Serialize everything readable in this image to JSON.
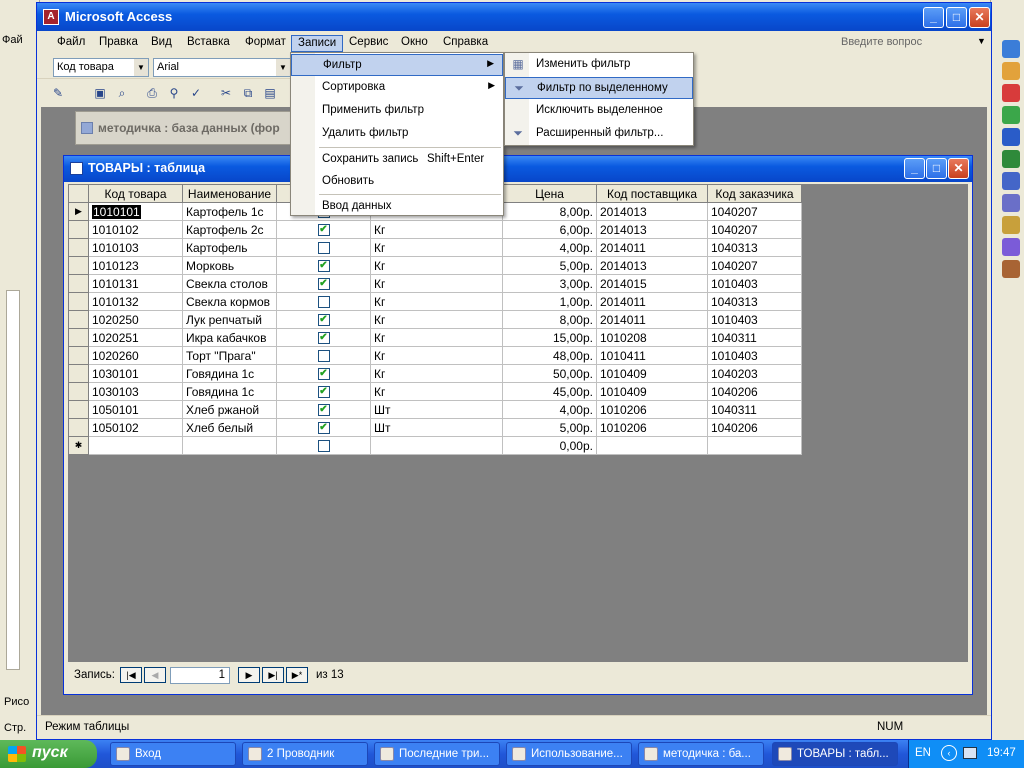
{
  "background_word": {
    "left_labels": [
      "Фай"
    ],
    "bottom_labels": [
      "Рисо",
      "Стр."
    ]
  },
  "access": {
    "title": "Microsoft Access",
    "menu": [
      "Файл",
      "Правка",
      "Вид",
      "Вставка",
      "Формат",
      "Записи",
      "Сервис",
      "Окно",
      "Справка"
    ],
    "ask_placeholder": "Введите вопрос",
    "field_combo": "Код товара",
    "font_combo": "Arial",
    "ghost_form_title": "методичка : база данных (фор",
    "status_text": "Режим таблицы",
    "status_num": "NUM"
  },
  "table_window": {
    "title": "ТОВАРЫ : таблица",
    "columns": [
      "Код товара",
      "Наименование",
      "О",
      "",
      "Цена",
      "Код поставщика",
      "Код заказчика"
    ],
    "rows": [
      {
        "code": "1010101",
        "name": "Картофель 1с",
        "checked": true,
        "unit": "Кг",
        "price": "8,00р.",
        "supplier": "2014013",
        "customer": "1040207"
      },
      {
        "code": "1010102",
        "name": "Картофель 2с",
        "checked": true,
        "unit": "Кг",
        "price": "6,00р.",
        "supplier": "2014013",
        "customer": "1040207"
      },
      {
        "code": "1010103",
        "name": "Картофель",
        "checked": false,
        "unit": "Кг",
        "price": "4,00р.",
        "supplier": "2014011",
        "customer": "1040313"
      },
      {
        "code": "1010123",
        "name": "Морковь",
        "checked": true,
        "unit": "Кг",
        "price": "5,00р.",
        "supplier": "2014013",
        "customer": "1040207"
      },
      {
        "code": "1010131",
        "name": "Свекла столов",
        "checked": true,
        "unit": "Кг",
        "price": "3,00р.",
        "supplier": "2014015",
        "customer": "1010403"
      },
      {
        "code": "1010132",
        "name": "Свекла кормов",
        "checked": false,
        "unit": "Кг",
        "price": "1,00р.",
        "supplier": "2014011",
        "customer": "1040313"
      },
      {
        "code": "1020250",
        "name": "Лук репчатый",
        "checked": true,
        "unit": "Кг",
        "price": "8,00р.",
        "supplier": "2014011",
        "customer": "1010403"
      },
      {
        "code": "1020251",
        "name": "Икра кабачков",
        "checked": true,
        "unit": "Кг",
        "price": "15,00р.",
        "supplier": "1010208",
        "customer": "1040311"
      },
      {
        "code": "1020260",
        "name": "Торт \"Прага\"",
        "checked": false,
        "unit": "Кг",
        "price": "48,00р.",
        "supplier": "1010411",
        "customer": "1010403"
      },
      {
        "code": "1030101",
        "name": "Говядина 1с",
        "checked": true,
        "unit": "Кг",
        "price": "50,00р.",
        "supplier": "1010409",
        "customer": "1040203"
      },
      {
        "code": "1030103",
        "name": "Говядина 1с",
        "checked": true,
        "unit": "Кг",
        "price": "45,00р.",
        "supplier": "1010409",
        "customer": "1040206"
      },
      {
        "code": "1050101",
        "name": "Хлеб ржаной",
        "checked": true,
        "unit": "Шт",
        "price": "4,00р.",
        "supplier": "1010206",
        "customer": "1040311"
      },
      {
        "code": "1050102",
        "name": "Хлеб белый",
        "checked": true,
        "unit": "Шт",
        "price": "5,00р.",
        "supplier": "1010206",
        "customer": "1040206"
      }
    ],
    "new_row_price": "0,00р.",
    "nav": {
      "label": "Запись:",
      "current": "1",
      "of_label": "из",
      "total": "13"
    }
  },
  "records_menu": {
    "items": [
      {
        "label": "Фильтр",
        "has_submenu": true
      },
      {
        "label": "Сортировка",
        "has_submenu": true
      },
      {
        "label": "Применить фильтр"
      },
      {
        "label": "Удалить фильтр"
      },
      {
        "label": "Сохранить запись",
        "shortcut": "Shift+Enter"
      },
      {
        "label": "Обновить"
      },
      {
        "label": "Ввод данных"
      }
    ]
  },
  "filter_submenu": {
    "items": [
      {
        "label": "Изменить фильтр",
        "icon": "funnel-form-icon"
      },
      {
        "label": "Фильтр по выделенному",
        "icon": "funnel-selection-icon"
      },
      {
        "label": "Исключить выделенное"
      },
      {
        "label": "Расширенный фильтр...",
        "icon": "funnel-advanced-icon"
      }
    ]
  },
  "taskbar": {
    "start": "пуск",
    "tasks": [
      "Вход",
      "2 Проводник",
      "Последние три...",
      "Использование...",
      "методичка : ба...",
      "ТОВАРЫ : табл..."
    ],
    "lang": "EN",
    "clock": "19:47"
  }
}
